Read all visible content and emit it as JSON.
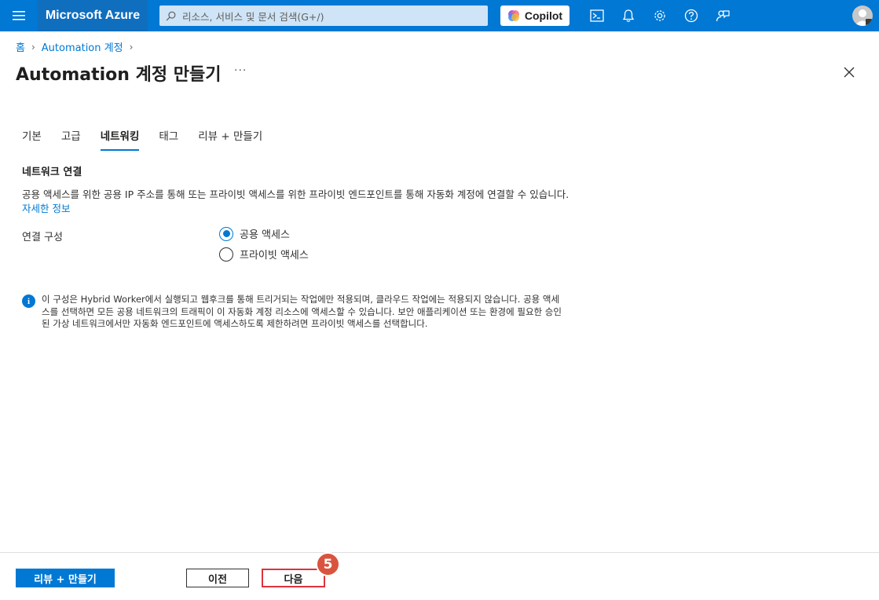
{
  "topbar": {
    "brand": "Microsoft Azure",
    "search_placeholder": "리소스, 서비스 및 문서 검색(G+/)",
    "copilot_label": "Copilot",
    "icons": [
      "menu-icon",
      "search-icon",
      "copilot-icon",
      "cloud-shell-icon",
      "bell-icon",
      "gear-icon",
      "help-icon",
      "feedback-icon",
      "avatar-icon"
    ],
    "accent": "#0078d4"
  },
  "breadcrumb": {
    "home": "홈",
    "automation": "Automation 계정"
  },
  "page": {
    "title": "Automation 계정 만들기",
    "more": "···"
  },
  "tabs": [
    {
      "label": "기본",
      "active": false
    },
    {
      "label": "고급",
      "active": false
    },
    {
      "label": "네트워킹",
      "active": true
    },
    {
      "label": "태그",
      "active": false
    },
    {
      "label": "리뷰 + 만들기",
      "active": false
    }
  ],
  "network": {
    "section_title": "네트워크 연결",
    "description": "공용 액세스를 위한 공용 IP 주소를 통해 또는 프라이빗 액세스를 위한 프라이빗 엔드포인트를 통해 자동화 계정에 연결할 수 있습니다.",
    "learn_more": "자세한 정보",
    "field_label": "연결 구성",
    "options": [
      {
        "label": "공용 액세스",
        "selected": true
      },
      {
        "label": "프라이빗 액세스",
        "selected": false
      }
    ],
    "info_text": "이 구성은 Hybrid Worker에서 실행되고 웹후크를 통해 트리거되는 작업에만 적용되며, 클라우드 작업에는 적용되지 않습니다. 공용 액세스를 선택하면 모든 공용 네트워크의 트래픽이 이 자동화 계정 리소스에 액세스할 수 있습니다. 보안 애플리케이션 또는 환경에 필요한 승인된 가상 네트워크에서만 자동화 엔드포인트에 액세스하도록 제한하려면 프라이빗 액세스를 선택합니다."
  },
  "footer": {
    "review_create": "리뷰 + 만들기",
    "previous": "이전",
    "next": "다음",
    "step_badge": "5",
    "highlight_color": "#e0323c"
  }
}
